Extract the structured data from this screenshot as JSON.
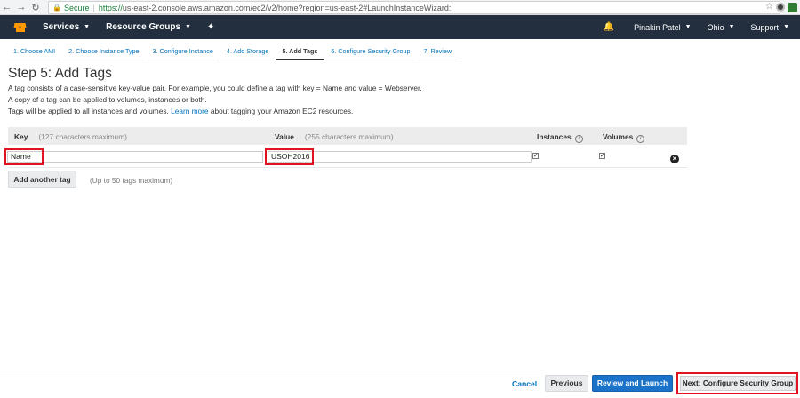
{
  "browser": {
    "secure_label": "Secure",
    "url_prefix": "https://",
    "url_host": "us-east-2.console.aws.amazon.com",
    "url_path": "/ec2/v2/home?region=us-east-2#LaunchInstanceWizard:"
  },
  "topnav": {
    "services": "Services",
    "resource_groups": "Resource Groups",
    "user": "Pinakin Patel",
    "region": "Ohio",
    "support": "Support"
  },
  "wizard_tabs": [
    {
      "label": "1. Choose AMI"
    },
    {
      "label": "2. Choose Instance Type"
    },
    {
      "label": "3. Configure Instance"
    },
    {
      "label": "4. Add Storage"
    },
    {
      "label": "5. Add Tags"
    },
    {
      "label": "6. Configure Security Group"
    },
    {
      "label": "7. Review"
    }
  ],
  "page": {
    "title": "Step 5: Add Tags",
    "desc1": "A tag consists of a case-sensitive key-value pair. For example, you could define a tag with key = Name and value = Webserver.",
    "desc2": "A copy of a tag can be applied to volumes, instances or both.",
    "desc3_pre": "Tags will be applied to all instances and volumes.",
    "desc3_link": "Learn more",
    "desc3_post": "about tagging your Amazon EC2 resources."
  },
  "table": {
    "key_header": "Key",
    "key_hint": "(127 characters maximum)",
    "value_header": "Value",
    "value_hint": "(255 characters maximum)",
    "instances_header": "Instances",
    "volumes_header": "Volumes",
    "rows": [
      {
        "key": "Name",
        "value": "USOH2016",
        "instances": true,
        "volumes": true
      }
    ]
  },
  "actions": {
    "add_tag": "Add another tag",
    "add_tag_note": "(Up to 50 tags maximum)",
    "cancel": "Cancel",
    "previous": "Previous",
    "review_launch": "Review and Launch",
    "next": "Next: Configure Security Group"
  },
  "colors": {
    "nav_bg": "#232f3e",
    "link": "#0073bb",
    "primary": "#1a73c8",
    "highlight": "#e0131e"
  }
}
